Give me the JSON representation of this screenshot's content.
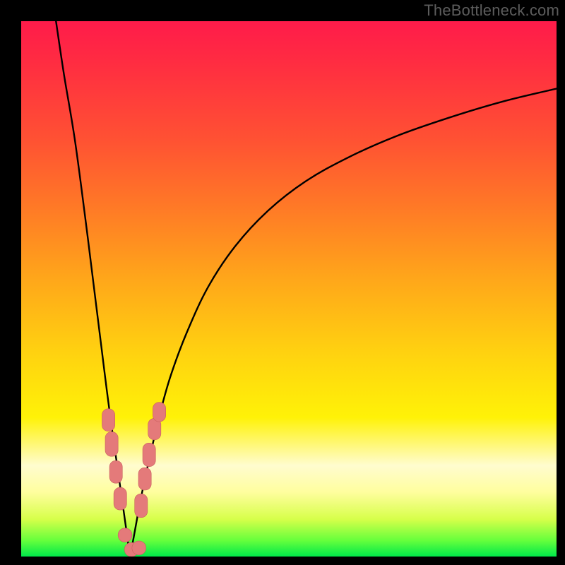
{
  "attribution": "TheBottleneck.com",
  "colors": {
    "curve_stroke": "#000000",
    "marker_fill": "#e47a7a",
    "marker_stroke": "#c95e5e",
    "frame": "#000000"
  },
  "chart_data": {
    "type": "line",
    "title": "",
    "xlabel": "",
    "ylabel": "",
    "xlim": [
      0,
      100
    ],
    "ylim": [
      0,
      100
    ],
    "axes_visible": false,
    "grid": false,
    "background_gradient": {
      "direction": "vertical",
      "stops": [
        {
          "pos": 0,
          "color": "#ff1b4a"
        },
        {
          "pos": 35,
          "color": "#ff7a26"
        },
        {
          "pos": 62,
          "color": "#ffd210"
        },
        {
          "pos": 83,
          "color": "#fffccf"
        },
        {
          "pos": 97,
          "color": "#66ff3c"
        },
        {
          "pos": 100,
          "color": "#00e84a"
        }
      ]
    },
    "series": [
      {
        "name": "curve-left",
        "x": [
          6.5,
          8,
          10,
          12,
          14,
          15,
          16,
          17,
          18,
          19,
          19.7,
          20.3
        ],
        "y": [
          100,
          90,
          78,
          63,
          47,
          39,
          31,
          23.5,
          16.5,
          9.5,
          4.5,
          0
        ]
      },
      {
        "name": "curve-right",
        "x": [
          20.3,
          21,
          22,
          23,
          24,
          26,
          28,
          31,
          35,
          40,
          46,
          53,
          61,
          70,
          80,
          90,
          100
        ],
        "y": [
          0,
          3.5,
          9,
          14,
          18.5,
          27,
          34,
          42,
          50.5,
          58,
          64.5,
          70,
          74.5,
          78.5,
          82,
          85,
          87.4
        ]
      }
    ],
    "scatter": {
      "name": "highlighted-points",
      "shape": "rounded-rect",
      "points": [
        {
          "x": 16.3,
          "y": 25.5,
          "w": 2.4,
          "h": 4.2
        },
        {
          "x": 16.9,
          "y": 21.0,
          "w": 2.4,
          "h": 4.6
        },
        {
          "x": 17.7,
          "y": 15.8,
          "w": 2.4,
          "h": 4.2
        },
        {
          "x": 18.5,
          "y": 10.8,
          "w": 2.4,
          "h": 4.2
        },
        {
          "x": 19.4,
          "y": 4.0,
          "w": 2.6,
          "h": 2.6
        },
        {
          "x": 20.6,
          "y": 1.3,
          "w": 2.6,
          "h": 2.6
        },
        {
          "x": 22.0,
          "y": 1.6,
          "w": 2.6,
          "h": 2.6
        },
        {
          "x": 22.4,
          "y": 9.5,
          "w": 2.4,
          "h": 4.4
        },
        {
          "x": 23.1,
          "y": 14.5,
          "w": 2.4,
          "h": 4.2
        },
        {
          "x": 23.9,
          "y": 19.0,
          "w": 2.4,
          "h": 4.4
        },
        {
          "x": 24.9,
          "y": 23.8,
          "w": 2.4,
          "h": 4.0
        },
        {
          "x": 25.8,
          "y": 27.0,
          "w": 2.4,
          "h": 3.6
        }
      ]
    }
  }
}
